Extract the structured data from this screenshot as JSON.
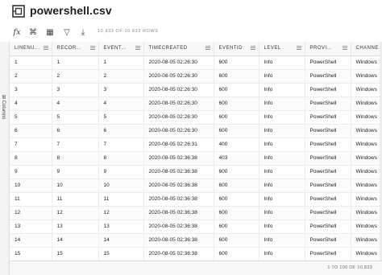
{
  "app": {
    "title": "powershell.csv"
  },
  "toolbar": {
    "items": [
      {
        "name": "formula-icon",
        "glyph": "fx"
      },
      {
        "name": "transform-icon",
        "glyph": "⌘"
      },
      {
        "name": "chart-icon",
        "glyph": "▦"
      },
      {
        "name": "filter-icon",
        "glyph": "▽"
      },
      {
        "name": "export-icon",
        "glyph": "⤓"
      }
    ],
    "row_count": "10,833 OF 10,833 ROWS"
  },
  "sidepanel": {
    "label": "Columns"
  },
  "table": {
    "columns": [
      "LINENU...",
      "RECOR...",
      "EVENT...",
      "TIMECREATED",
      "EVENTID",
      "LEVEL",
      "PROVI...",
      "CHANNE"
    ],
    "rows": [
      [
        "1",
        "1",
        "1",
        "2020-08-05 02:26:30",
        "600",
        "Info",
        "PowerShell",
        "Windows"
      ],
      [
        "2",
        "2",
        "2",
        "2020-08-05 02:26:30",
        "600",
        "Info",
        "PowerShell",
        "Windows"
      ],
      [
        "3",
        "3",
        "3",
        "2020-08-05 02:26:30",
        "600",
        "Info",
        "PowerShell",
        "Windows"
      ],
      [
        "4",
        "4",
        "4",
        "2020-08-05 02:26:30",
        "600",
        "Info",
        "PowerShell",
        "Windows"
      ],
      [
        "5",
        "5",
        "5",
        "2020-08-05 02:26:30",
        "600",
        "Info",
        "PowerShell",
        "Windows"
      ],
      [
        "6",
        "6",
        "6",
        "2020-08-05 02:26:30",
        "600",
        "Info",
        "PowerShell",
        "Windows"
      ],
      [
        "7",
        "7",
        "7",
        "2020-08-05 02:26:31",
        "400",
        "Info",
        "PowerShell",
        "Windows"
      ],
      [
        "8",
        "8",
        "8",
        "2020-08-05 02:36:38",
        "403",
        "Info",
        "PowerShell",
        "Windows"
      ],
      [
        "9",
        "9",
        "9",
        "2020-08-05 02:36:38",
        "600",
        "Info",
        "PowerShell",
        "Windows"
      ],
      [
        "10",
        "10",
        "10",
        "2020-08-05 02:36:38",
        "600",
        "Info",
        "PowerShell",
        "Windows"
      ],
      [
        "11",
        "11",
        "11",
        "2020-08-05 02:36:38",
        "600",
        "Info",
        "PowerShell",
        "Windows"
      ],
      [
        "12",
        "12",
        "12",
        "2020-08-05 02:36:38",
        "600",
        "Info",
        "PowerShell",
        "Windows"
      ],
      [
        "13",
        "13",
        "13",
        "2020-08-05 02:36:38",
        "600",
        "Info",
        "PowerShell",
        "Windows"
      ],
      [
        "14",
        "14",
        "14",
        "2020-08-05 02:36:38",
        "600",
        "Info",
        "PowerShell",
        "Windows"
      ],
      [
        "15",
        "15",
        "15",
        "2020-08-05 02:36:38",
        "600",
        "Info",
        "PowerShell",
        "Windows"
      ]
    ]
  },
  "footer": {
    "range": "1 TO 100 OF 10,833"
  }
}
